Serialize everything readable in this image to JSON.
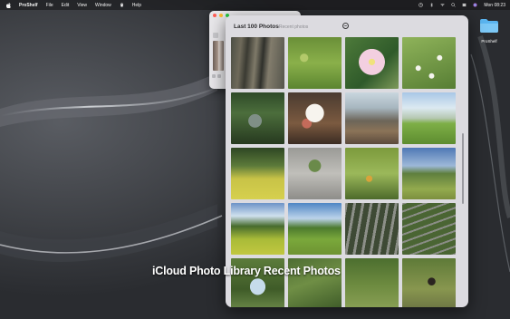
{
  "menubar": {
    "app_name": "ProShelf",
    "menus": [
      "File",
      "Edit",
      "View",
      "Window"
    ],
    "help": "Help",
    "clock": "Mon 08:23"
  },
  "desktop": {
    "folder_label": "ProShelf",
    "folder_color": "#5ab4ef"
  },
  "photos_window": {
    "title": "Last 100 Photos",
    "subtitle": "Recent photos",
    "photo_count": 20
  },
  "caption": "iCloud Photo Library Recent Photos",
  "colors": {
    "traffic_red": "#ff5f57",
    "traffic_yellow": "#febc2e",
    "traffic_green": "#28c840"
  }
}
